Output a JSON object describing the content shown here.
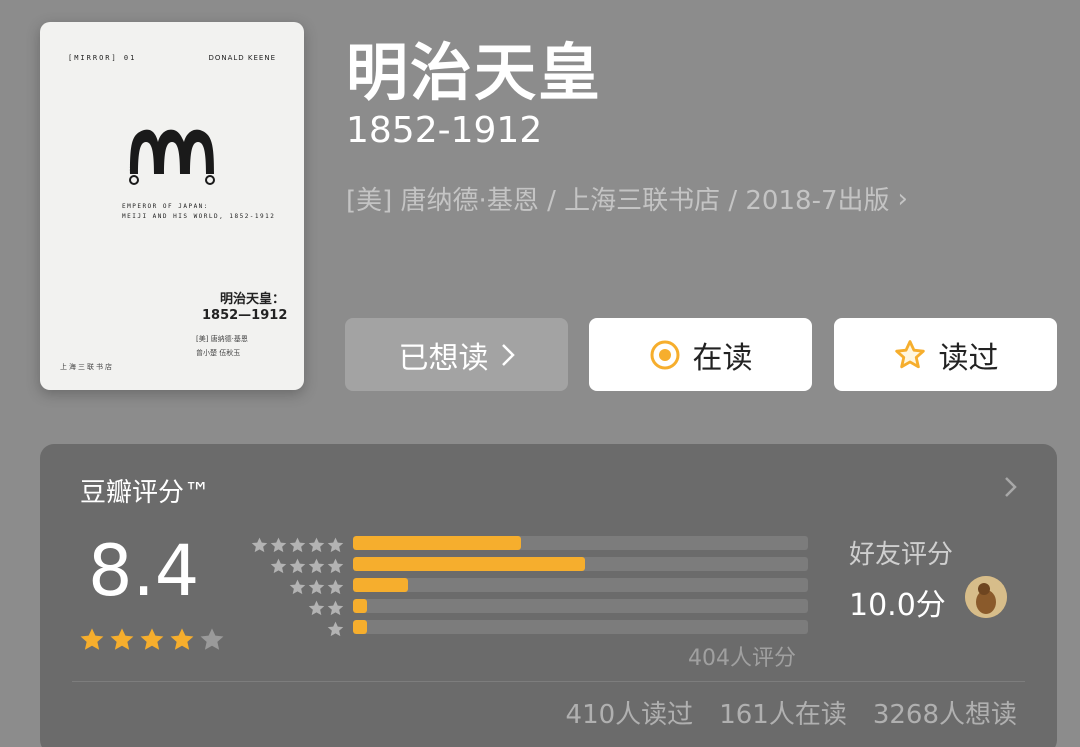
{
  "cover": {
    "series": "[MIRROR] 01",
    "author": "DONALD KEENE",
    "subtitle_en_line1": "EMPEROR OF JAPAN:",
    "subtitle_en_line2": "MEIJI AND HIS WORLD, 1852-1912",
    "title_cn": "明治天皇：",
    "years_cn": "1852—1912",
    "credit_author": "[美] 唐纳德·基恩",
    "credit_translator": "曾小楚 伍秋玉",
    "publisher": "上海三联书店"
  },
  "book": {
    "title": "明治天皇",
    "subtitle": "1852-1912",
    "meta": "[美] 唐纳德·基恩 / 上海三联书店 / 2018-7出版"
  },
  "actions": {
    "want": "已想读",
    "reading": "在读",
    "read": "读过"
  },
  "rating": {
    "label": "豆瓣评分™",
    "score": "8.4",
    "stars_filled": 4,
    "stars_total": 5,
    "distribution": [
      {
        "stars": 5,
        "fraction": 0.37
      },
      {
        "stars": 4,
        "fraction": 0.51
      },
      {
        "stars": 3,
        "fraction": 0.12
      },
      {
        "stars": 2,
        "fraction": 0.03
      },
      {
        "stars": 1,
        "fraction": 0.03
      }
    ],
    "count_text": "404人评分",
    "friend_label": "好友评分",
    "friend_score": "10.0分"
  },
  "stats": {
    "read": "410人读过",
    "reading": "161人在读",
    "want": "3268人想读"
  },
  "colors": {
    "background": "#8c8c8c",
    "panel": "#6b6b6b",
    "accent": "#f6ae2d",
    "muted_button": "#a3a3a3"
  }
}
